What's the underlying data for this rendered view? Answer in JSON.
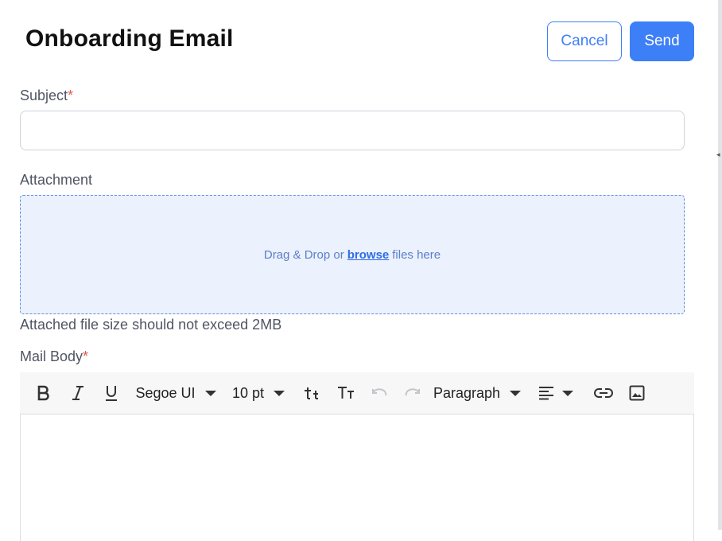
{
  "header": {
    "title": "Onboarding Email",
    "cancel_label": "Cancel",
    "send_label": "Send"
  },
  "subject": {
    "label": "Subject",
    "required_mark": "*",
    "value": "",
    "placeholder": ""
  },
  "attachment": {
    "label": "Attachment",
    "drop_text_before": "Drag & Drop or",
    "browse_label": "browse",
    "drop_text_after": "files here",
    "size_hint": "Attached file size should not exceed 2MB"
  },
  "mail_body": {
    "label": "Mail Body",
    "required_mark": "*",
    "toolbar": {
      "icons": [
        "bold-icon",
        "italic-icon",
        "underline-icon",
        "font-size-increase-icon",
        "font-size-decrease-icon",
        "undo-icon",
        "redo-icon",
        "align-left-icon",
        "link-icon",
        "image-icon"
      ],
      "font_family": "Segoe UI",
      "font_size": "10 pt",
      "block_format": "Paragraph"
    },
    "content": ""
  },
  "colors": {
    "primary": "#3d7ff6",
    "required": "#e4564f",
    "dropzone_bg": "#ebf1fd",
    "dropzone_border": "#5b8ee6"
  }
}
